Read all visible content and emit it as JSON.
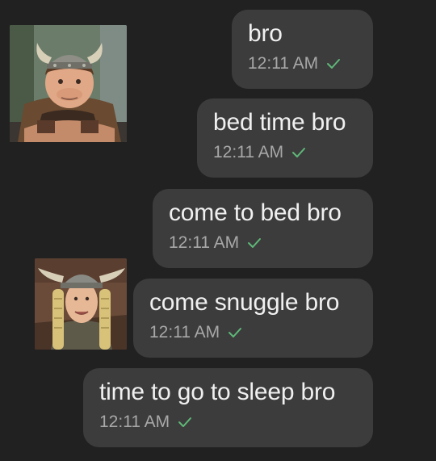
{
  "colors": {
    "background": "#212121",
    "bubble": "#3c3c3c",
    "message_text": "#f0f0f0",
    "timestamp": "#a8a8a8",
    "read_check": "#5fb878"
  },
  "messages": [
    {
      "text": "bro",
      "time": "12:11 AM",
      "status_icon": "check-icon"
    },
    {
      "text": "bed time bro",
      "time": "12:11 AM",
      "status_icon": "check-icon"
    },
    {
      "text": "come to bed bro",
      "time": "12:11 AM",
      "status_icon": "check-icon"
    },
    {
      "text": "come snuggle bro",
      "time": "12:11 AM",
      "status_icon": "check-icon"
    },
    {
      "text": "time to go to sleep bro",
      "time": "12:11 AM",
      "status_icon": "check-icon"
    }
  ],
  "stickers": [
    {
      "icon": "viking-character-sticker"
    },
    {
      "icon": "viking-character-sticker"
    }
  ]
}
